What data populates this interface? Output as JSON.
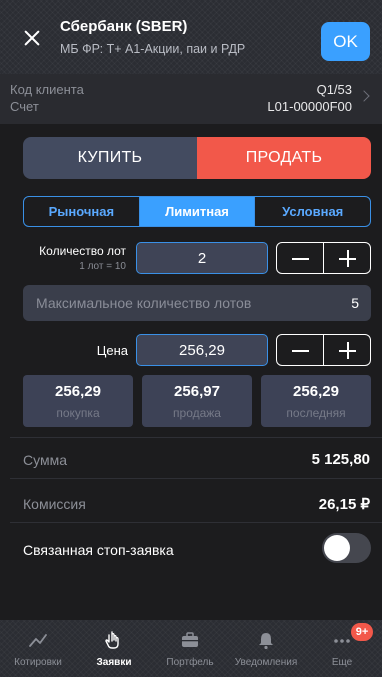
{
  "header": {
    "title": "Сбербанк (SBER)",
    "subtitle": "МБ ФР: Т+ А1-Акции, паи и РДР",
    "ok_label": "OK"
  },
  "client": {
    "code_label": "Код клиента",
    "account_label": "Счет",
    "code_value": "Q1/53",
    "account_value": "L01-00000F00"
  },
  "side": {
    "buy_label": "КУПИТЬ",
    "sell_label": "ПРОДАТЬ",
    "selected": "sell"
  },
  "order_types": [
    {
      "label": "Рыночная",
      "active": false
    },
    {
      "label": "Лимитная",
      "active": true
    },
    {
      "label": "Условная",
      "active": false
    }
  ],
  "quantity": {
    "label": "Количество лот",
    "lot_size": "1 лот = 10",
    "value": "2"
  },
  "max_lots": {
    "label": "Максимальное количество лотов",
    "value": "5"
  },
  "price": {
    "label": "Цена",
    "value": "256,29"
  },
  "quick_prices": [
    {
      "value": "256,29",
      "label": "покупка"
    },
    {
      "value": "256,97",
      "label": "продажа"
    },
    {
      "value": "256,29",
      "label": "последняя"
    }
  ],
  "summary": {
    "sum_label": "Сумма",
    "sum_value": "5 125,80",
    "commission_label": "Комиссия",
    "commission_value": "26,15 ₽"
  },
  "stop_order": {
    "label": "Связанная стоп-заявка",
    "enabled": false
  },
  "tabs": [
    {
      "label": "Котировки",
      "icon": "chart-line-icon",
      "active": false
    },
    {
      "label": "Заявки",
      "icon": "hand-pointer-icon",
      "active": true
    },
    {
      "label": "Портфель",
      "icon": "briefcase-icon",
      "active": false
    },
    {
      "label": "Уведомления",
      "icon": "bell-icon",
      "active": false
    },
    {
      "label": "Еще",
      "icon": "more-dots-icon",
      "active": false,
      "badge": "9+"
    }
  ],
  "colors": {
    "accent": "#3aa0ff",
    "sell": "#f2584a",
    "buy": "#434b60",
    "background": "#1c1c1e"
  }
}
